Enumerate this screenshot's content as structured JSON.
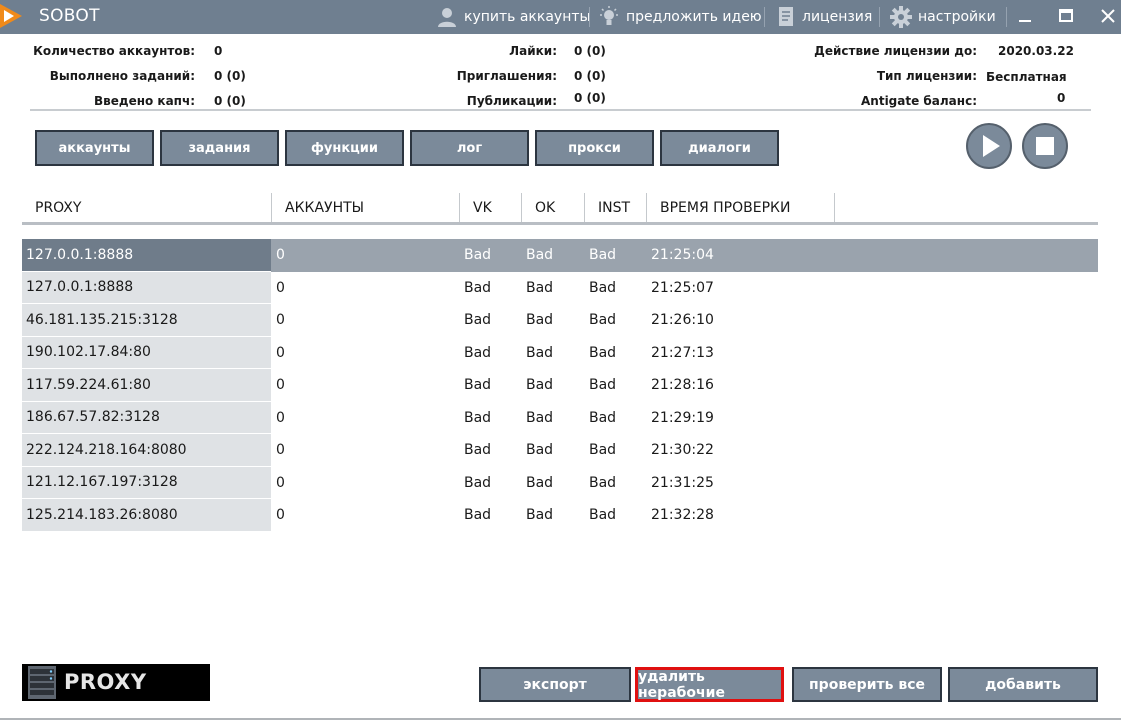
{
  "app": {
    "title": "SOBOT"
  },
  "menu": {
    "buy": "купить аккаунты",
    "idea": "предложить идею",
    "license": "лицензия",
    "settings": "настройки"
  },
  "stats": {
    "accounts_label": "Количество аккаунтов:",
    "accounts_value": "0",
    "tasks_label": "Выполнено заданий:",
    "tasks_value": "0 (0)",
    "captcha_label": "Введено капч:",
    "captcha_value": "0 (0)",
    "likes_label": "Лайки:",
    "likes_value": "0 (0)",
    "invites_label": "Приглашения:",
    "invites_value": "0 (0)",
    "posts_label": "Публикации:",
    "posts_value": "0 (0)",
    "license_until_label": "Действие лицензии до:",
    "license_until_value": "2020.03.22",
    "license_type_label": "Тип лицензии:",
    "license_type_value": "Бесплатная",
    "antigate_label": "Antigate баланс:",
    "antigate_value": "0"
  },
  "tabs": [
    "аккаунты",
    "задания",
    "функции",
    "лог",
    "прокси",
    "диалоги"
  ],
  "table": {
    "headers": [
      "PROXY",
      "АККАУНТЫ",
      "VK",
      "OK",
      "INST",
      "ВРЕМЯ ПРОВЕРКИ"
    ],
    "rows": [
      {
        "proxy": "127.0.0.1:8888",
        "accounts": "0",
        "vk": "Bad",
        "ok": "Bad",
        "inst": "Bad",
        "time": "21:25:04"
      },
      {
        "proxy": "127.0.0.1:8888",
        "accounts": "0",
        "vk": "Bad",
        "ok": "Bad",
        "inst": "Bad",
        "time": "21:25:07"
      },
      {
        "proxy": "46.181.135.215:3128",
        "accounts": "0",
        "vk": "Bad",
        "ok": "Bad",
        "inst": "Bad",
        "time": "21:26:10"
      },
      {
        "proxy": "190.102.17.84:80",
        "accounts": "0",
        "vk": "Bad",
        "ok": "Bad",
        "inst": "Bad",
        "time": "21:27:13"
      },
      {
        "proxy": "117.59.224.61:80",
        "accounts": "0",
        "vk": "Bad",
        "ok": "Bad",
        "inst": "Bad",
        "time": "21:28:16"
      },
      {
        "proxy": "186.67.57.82:3128",
        "accounts": "0",
        "vk": "Bad",
        "ok": "Bad",
        "inst": "Bad",
        "time": "21:29:19"
      },
      {
        "proxy": "222.124.218.164:8080",
        "accounts": "0",
        "vk": "Bad",
        "ok": "Bad",
        "inst": "Bad",
        "time": "21:30:22"
      },
      {
        "proxy": "121.12.167.197:3128",
        "accounts": "0",
        "vk": "Bad",
        "ok": "Bad",
        "inst": "Bad",
        "time": "21:31:25"
      },
      {
        "proxy": "125.214.183.26:8080",
        "accounts": "0",
        "vk": "Bad",
        "ok": "Bad",
        "inst": "Bad",
        "time": "21:32:28"
      }
    ]
  },
  "footer": {
    "logo_text": "PROXY",
    "export": "экспорт",
    "delete_broken": "удалить нерабочие",
    "check_all": "проверить все",
    "add": "добавить"
  },
  "colors": {
    "titlebar": "#6f7f90",
    "button": "#7b8a9a",
    "selected_row": "#9aa3ad",
    "highlight_border": "#e01010"
  },
  "icons": [
    "app-logo-icon",
    "user-icon",
    "lightbulb-icon",
    "document-icon",
    "gear-icon",
    "minimize-icon",
    "maximize-icon",
    "close-icon",
    "play-icon",
    "stop-icon",
    "server-icon"
  ]
}
